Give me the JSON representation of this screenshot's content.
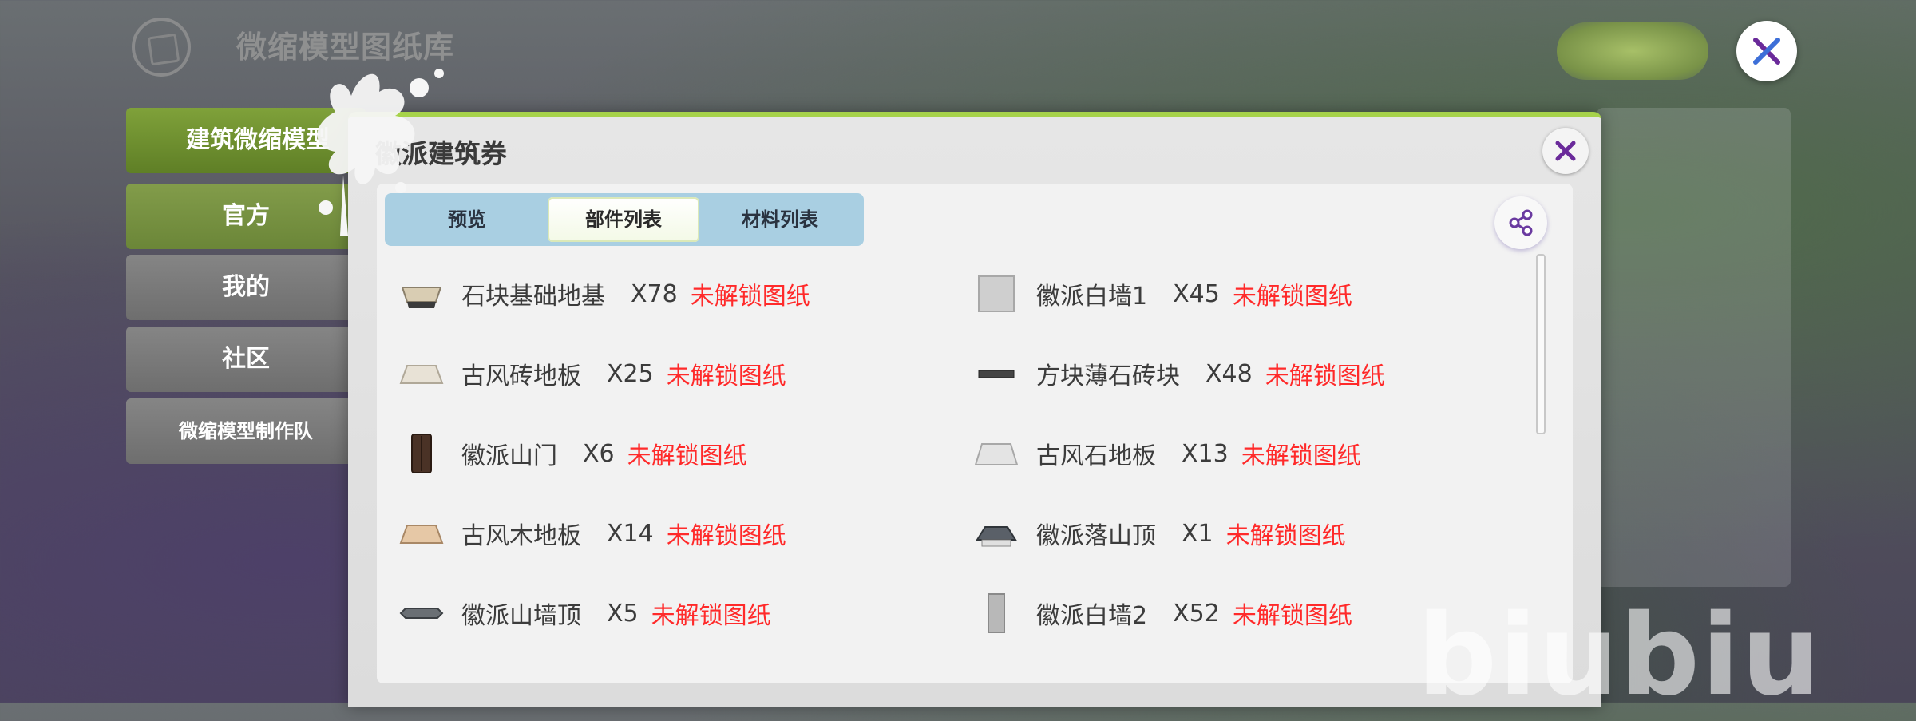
{
  "header": {
    "title": "微缩模型图纸库"
  },
  "sidebar": {
    "items": [
      {
        "label": "建筑微缩模型"
      },
      {
        "label": "官方"
      },
      {
        "label": "我的"
      },
      {
        "label": "社区"
      },
      {
        "label": "微缩模型制作队"
      }
    ]
  },
  "modal": {
    "title": "徽派建筑券",
    "tabs": [
      {
        "label": "预览"
      },
      {
        "label": "部件列表",
        "active": true
      },
      {
        "label": "材料列表"
      }
    ],
    "parts_left": [
      {
        "name": "石块基础地基",
        "qty": "X78",
        "status": "未解锁图纸",
        "icon": "stone-foundation-icon"
      },
      {
        "name": "古风砖地板",
        "qty": "X25",
        "status": "未解锁图纸",
        "icon": "brick-floor-icon"
      },
      {
        "name": "徽派山门",
        "qty": "X6",
        "status": "未解锁图纸",
        "icon": "door-icon"
      },
      {
        "name": "古风木地板",
        "qty": "X14",
        "status": "未解锁图纸",
        "icon": "wood-floor-icon"
      },
      {
        "name": "徽派山墙顶",
        "qty": "X5",
        "status": "未解锁图纸",
        "icon": "gable-roof-icon"
      }
    ],
    "parts_right": [
      {
        "name": "徽派白墙1",
        "qty": "X45",
        "status": "未解锁图纸",
        "icon": "white-wall-icon"
      },
      {
        "name": "方块薄石砖块",
        "qty": "X48",
        "status": "未解锁图纸",
        "icon": "thin-stone-brick-icon"
      },
      {
        "name": "古风石地板",
        "qty": "X13",
        "status": "未解锁图纸",
        "icon": "stone-floor-icon"
      },
      {
        "name": "徽派落山顶",
        "qty": "X1",
        "status": "未解锁图纸",
        "icon": "hip-roof-icon"
      },
      {
        "name": "徽派白墙2",
        "qty": "X52",
        "status": "未解锁图纸",
        "icon": "white-wall-2-icon"
      }
    ]
  },
  "colors": {
    "accent": "#a6d24a",
    "locked": "#ff2a2a",
    "tab_bg": "#a9cfe2",
    "close_x": "#6a2a9a"
  },
  "watermark": "biubiu"
}
